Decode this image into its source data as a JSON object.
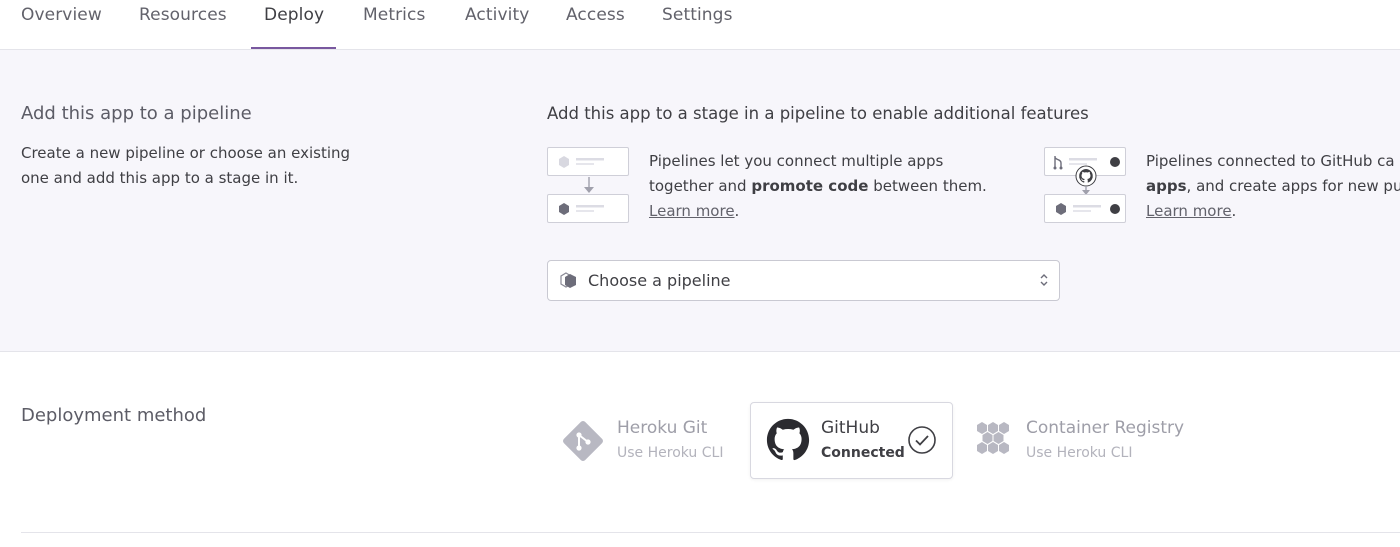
{
  "tabs": [
    {
      "label": "Overview"
    },
    {
      "label": "Resources"
    },
    {
      "label": "Deploy"
    },
    {
      "label": "Metrics"
    },
    {
      "label": "Activity"
    },
    {
      "label": "Access"
    },
    {
      "label": "Settings"
    }
  ],
  "active_tab": "Deploy",
  "pipeline": {
    "title": "Add this app to a pipeline",
    "description_line1": "Create a new pipeline or choose an existing",
    "description_line2": "one and add this app to a stage in it.",
    "stage_title": "Add this app to a stage in a pipeline to enable additional features",
    "feature1": {
      "line1": "Pipelines let you connect multiple apps",
      "line2_prefix": "together and ",
      "line2_bold": "promote code",
      "line2_suffix": " between them.",
      "link": "Learn more",
      "link_suffix": "."
    },
    "feature2": {
      "line1": "Pipelines connected to GitHub ca",
      "line2_bold": "apps",
      "line2_suffix": ", and create apps for new pu",
      "link": "Learn more",
      "link_suffix": "."
    },
    "select_label": "Choose a pipeline"
  },
  "deployment": {
    "title": "Deployment method",
    "methods": [
      {
        "name": "Heroku Git",
        "sub": "Use Heroku CLI",
        "icon": "heroku-git-icon"
      },
      {
        "name": "GitHub",
        "sub": "Connected",
        "icon": "github-icon",
        "selected": true
      },
      {
        "name": "Container Registry",
        "sub": "Use Heroku CLI",
        "icon": "container-registry-icon"
      }
    ]
  },
  "colors": {
    "accent": "#79589f",
    "section_bg": "#f7f6fb",
    "muted_text": "#9e9ea8"
  }
}
